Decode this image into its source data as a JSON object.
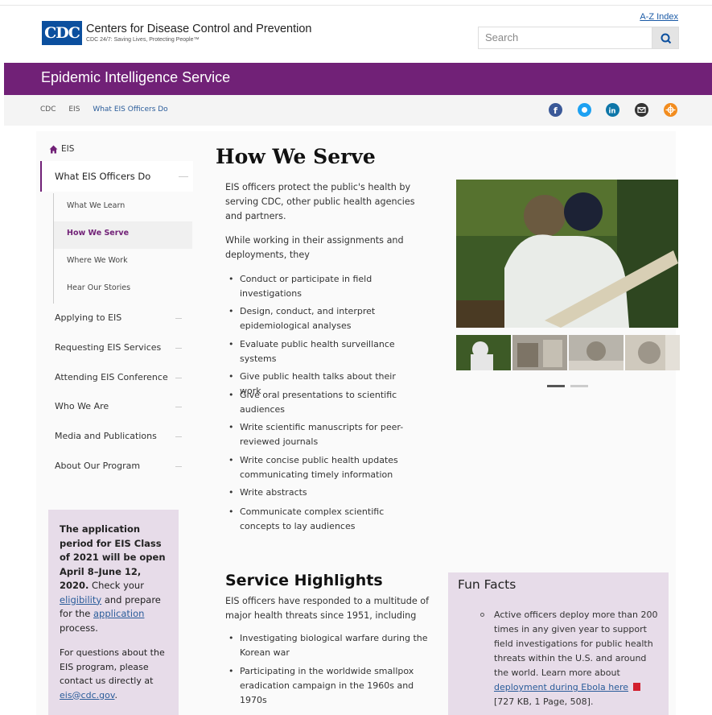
{
  "header": {
    "logo_text": "CDC",
    "site_title": "Centers for Disease Control and Prevention",
    "tagline": "CDC 24/7: Saving Lives, Protecting People™",
    "az_index": "A-Z Index",
    "search_placeholder": "Search"
  },
  "banner": {
    "title": "Epidemic Intelligence Service"
  },
  "breadcrumb": {
    "items": [
      "CDC",
      "EIS",
      "What EIS Officers Do"
    ]
  },
  "social": [
    "facebook-icon",
    "twitter-icon",
    "linkedin-icon",
    "email-icon",
    "syndicate-icon"
  ],
  "sidebar": {
    "home": "EIS",
    "parent": "What EIS Officers Do",
    "sub_items": [
      "What We Learn",
      "How We Serve",
      "Where We Work",
      "Hear Our Stories"
    ],
    "items": [
      "Applying to EIS",
      "Requesting EIS Services",
      "Attending EIS Conference",
      "Who We Are",
      "Media and Publications",
      "About Our Program"
    ],
    "application": {
      "p1_start": "The application period for EIS Class of 2021 will be open April 8–June 12, 2020.",
      "p1_check": " Check your ",
      "eligibility": "eligibility",
      "p1_mid": " and prepare for the ",
      "application": "application",
      "p1_end": " process.",
      "p2": "For questions about the EIS program, please contact us directly at ",
      "email": "eis@cdc.gov",
      "p2_end": "."
    }
  },
  "main": {
    "title": "How We Serve",
    "intro": "EIS officers protect the public's health by serving CDC, other public health agencies and partners.",
    "intro2": "While working in their assignments and deployments, they",
    "bullets": [
      "Conduct or participate in field investigations",
      "Design, conduct, and interpret epidemiological analyses",
      "Evaluate public health surveillance systems",
      "Give public health talks about their work",
      "Give oral presentations to scientific audiences",
      "Write scientific manuscripts for peer-reviewed journals",
      "Write concise public health updates communicating timely information",
      "Write abstracts",
      "Communicate complex scientific concepts to lay audiences"
    ],
    "highlights_title": "Service Highlights",
    "highlights_intro": "EIS officers have responded to a multitude of major health threats since 1951, including",
    "highlights": [
      "Investigating biological warfare during the Korean war",
      "Participating in the worldwide smallpox eradication campaign in the 1960s and 1970s"
    ]
  },
  "fun_facts": {
    "title": "Fun Facts",
    "text": "Active officers deploy more than 200 times in any given year to support field investigations for public health threats within the U.S. and around the world. Learn more about ",
    "link": "deployment during Ebola here",
    "pdf": "[727 KB, 1 Page, 508]",
    "end": "."
  },
  "colors": {
    "brand_purple": "#712177",
    "cdc_blue": "#0b4f9e",
    "link": "#2a5c9a"
  }
}
